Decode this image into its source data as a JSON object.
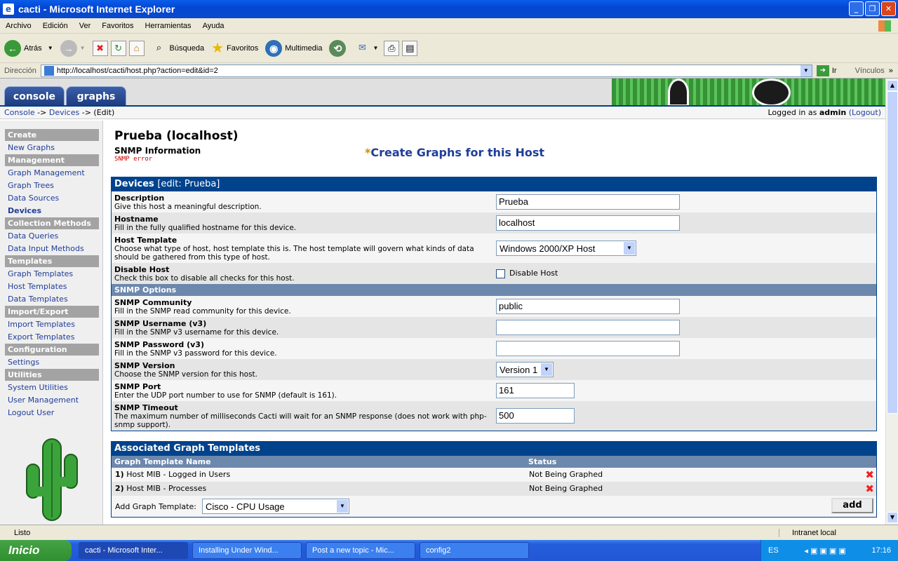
{
  "window": {
    "title": "cacti - Microsoft Internet Explorer"
  },
  "menu": [
    "Archivo",
    "Edición",
    "Ver",
    "Favoritos",
    "Herramientas",
    "Ayuda"
  ],
  "toolbar": {
    "back": "Atrás",
    "search": "Búsqueda",
    "favorites": "Favoritos",
    "media": "Multimedia"
  },
  "address": {
    "label": "Dirección",
    "url": "http://localhost/cacti/host.php?action=edit&id=2",
    "go": "Ir",
    "links": "Vínculos"
  },
  "tabs": {
    "console": "console",
    "graphs": "graphs"
  },
  "breadcrumb": {
    "console": "Console",
    "sep1": "->",
    "devices": "Devices",
    "sep2": "->",
    "edit": "(Edit)"
  },
  "login": {
    "prefix": "Logged in as",
    "user": "admin",
    "logout": "(Logout)"
  },
  "nav": [
    {
      "type": "hd",
      "label": "Create"
    },
    {
      "type": "it",
      "label": "New Graphs"
    },
    {
      "type": "hd",
      "label": "Management"
    },
    {
      "type": "it",
      "label": "Graph Management"
    },
    {
      "type": "it",
      "label": "Graph Trees"
    },
    {
      "type": "it",
      "label": "Data Sources"
    },
    {
      "type": "it",
      "label": "Devices",
      "active": true
    },
    {
      "type": "hd",
      "label": "Collection Methods"
    },
    {
      "type": "it",
      "label": "Data Queries"
    },
    {
      "type": "it",
      "label": "Data Input Methods"
    },
    {
      "type": "hd",
      "label": "Templates"
    },
    {
      "type": "it",
      "label": "Graph Templates"
    },
    {
      "type": "it",
      "label": "Host Templates"
    },
    {
      "type": "it",
      "label": "Data Templates"
    },
    {
      "type": "hd",
      "label": "Import/Export"
    },
    {
      "type": "it",
      "label": "Import Templates"
    },
    {
      "type": "it",
      "label": "Export Templates"
    },
    {
      "type": "hd",
      "label": "Configuration"
    },
    {
      "type": "it",
      "label": "Settings"
    },
    {
      "type": "hd",
      "label": "Utilities"
    },
    {
      "type": "it",
      "label": "System Utilities"
    },
    {
      "type": "it",
      "label": "User Management"
    },
    {
      "type": "it",
      "label": "Logout User"
    }
  ],
  "host": {
    "title": "Prueba (localhost)",
    "snmp_info": "SNMP Information",
    "snmp_error": "SNMP error",
    "create_graphs": "Create Graphs for this Host",
    "star": "*"
  },
  "devices": {
    "title": "Devices",
    "edit": "[edit: Prueba]",
    "description": {
      "label": "Description",
      "help": "Give this host a meaningful description.",
      "value": "Prueba"
    },
    "hostname": {
      "label": "Hostname",
      "help": "Fill in the fully qualified hostname for this device.",
      "value": "localhost"
    },
    "host_template": {
      "label": "Host Template",
      "help": "Choose what type of host, host template this is. The host template will govern what kinds of data should be gathered from this type of host.",
      "value": "Windows 2000/XP Host"
    },
    "disable": {
      "label": "Disable Host",
      "help": "Check this box to disable all checks for this host.",
      "checkbox_label": "Disable Host"
    },
    "snmp_options": "SNMP Options",
    "community": {
      "label": "SNMP Community",
      "help": "Fill in the SNMP read community for this device.",
      "value": "public"
    },
    "username": {
      "label": "SNMP Username (v3)",
      "help": "Fill in the SNMP v3 username for this device.",
      "value": ""
    },
    "password": {
      "label": "SNMP Password (v3)",
      "help": "Fill in the SNMP v3 password for this device.",
      "value": ""
    },
    "version": {
      "label": "SNMP Version",
      "help": "Choose the SNMP version for this host.",
      "value": "Version 1"
    },
    "port": {
      "label": "SNMP Port",
      "help": "Enter the UDP port number to use for SNMP (default is 161).",
      "value": "161"
    },
    "timeout": {
      "label": "SNMP Timeout",
      "help": "The maximum number of milliseconds Cacti will wait for an SNMP response (does not work with php-snmp support).",
      "value": "500"
    }
  },
  "templates": {
    "title": "Associated Graph Templates",
    "col_name": "Graph Template Name",
    "col_status": "Status",
    "rows": [
      {
        "num": "1)",
        "name": "Host MIB - Logged in Users",
        "status": "Not Being Graphed"
      },
      {
        "num": "2)",
        "name": "Host MIB - Processes",
        "status": "Not Being Graphed"
      }
    ],
    "add_label": "Add Graph Template:",
    "add_value": "Cisco - CPU Usage",
    "add_button": "add"
  },
  "status": {
    "text": "Listo",
    "zone": "Intranet local"
  },
  "taskbar": {
    "start": "Inicio",
    "tasks": [
      "cacti - Microsoft Inter...",
      "Installing Under Wind...",
      "Post a new topic - Mic...",
      "config2"
    ],
    "lang": "ES",
    "clock": "17:16"
  }
}
